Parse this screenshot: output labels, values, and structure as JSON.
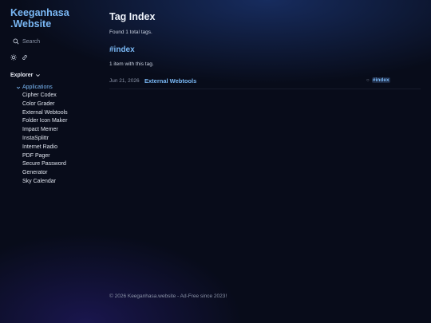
{
  "sidebar": {
    "site_title_line1": "Keeganhasa",
    "site_title_line2": ".Website",
    "search_placeholder": "Search",
    "explorer_label": "Explorer",
    "folder_label": "Applications",
    "items": [
      {
        "label": "Cipher Codex"
      },
      {
        "label": "Color Grader"
      },
      {
        "label": "External Webtools"
      },
      {
        "label": "Folder Icon Maker"
      },
      {
        "label": "Impact Memer"
      },
      {
        "label": "InstaSplittr"
      },
      {
        "label": "Internet Radio"
      },
      {
        "label": "PDF Pager"
      },
      {
        "label": "Secure Password"
      },
      {
        "label": "Generator"
      },
      {
        "label": "Sky Calendar"
      }
    ],
    "icons": [
      "search-icon",
      "sun-icon",
      "link-icon",
      "chevron-down-icon"
    ]
  },
  "main": {
    "title": "Tag Index",
    "summary": "Found 1 total tags.",
    "tag_heading": "#index",
    "count_text": "1 item with this tag.",
    "entries": [
      {
        "date": "Jun 21, 2026",
        "title": "External Webtools",
        "tag": "#index"
      }
    ]
  },
  "footer": {
    "text": "© 2026 Keeganhasa.website - Ad-Free since 2023!"
  },
  "colors": {
    "accent": "#7ab8f5",
    "background": "#080c1a",
    "text": "#c9d1e0",
    "muted": "#8b94a8"
  }
}
